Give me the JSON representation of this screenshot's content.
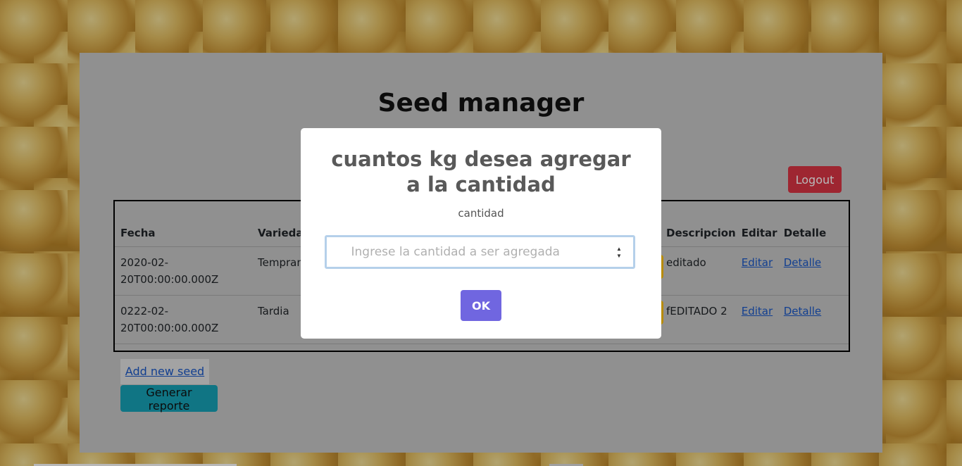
{
  "page": {
    "title": "Seed manager",
    "logout_label": "Logout",
    "add_seed_label": "Add new seed",
    "report_label": "Generar reporte"
  },
  "table": {
    "headers": {
      "fecha": "Fecha",
      "variedad": "Variedad",
      "descripcion": "Descripcion",
      "editar": "Editar",
      "detalle": "Detalle"
    },
    "rows": [
      {
        "fecha_1": "2020-02-",
        "fecha_2": "20T00:00:00.000Z",
        "variedad": "Tempran",
        "descripcion": "editado",
        "editar": "Editar",
        "detalle": "Detalle"
      },
      {
        "fecha_1": "0222-02-",
        "fecha_2": "20T00:00:00.000Z",
        "variedad": "Tardia",
        "descripcion": "fEDITADO 2",
        "editar": "Editar",
        "detalle": "Detalle"
      }
    ]
  },
  "modal": {
    "title": "cuantos kg desea agregar a la cantidad",
    "label": "cantidad",
    "input_value": "",
    "input_placeholder": "Ingrese la cantidad a ser agregada",
    "ok_label": "OK"
  },
  "colors": {
    "logout": "#dc3545",
    "report": "#17a2b8",
    "ok": "#7066e0",
    "action": "#ffc107"
  },
  "icons": {
    "spinner": "number-stepper-icon"
  }
}
